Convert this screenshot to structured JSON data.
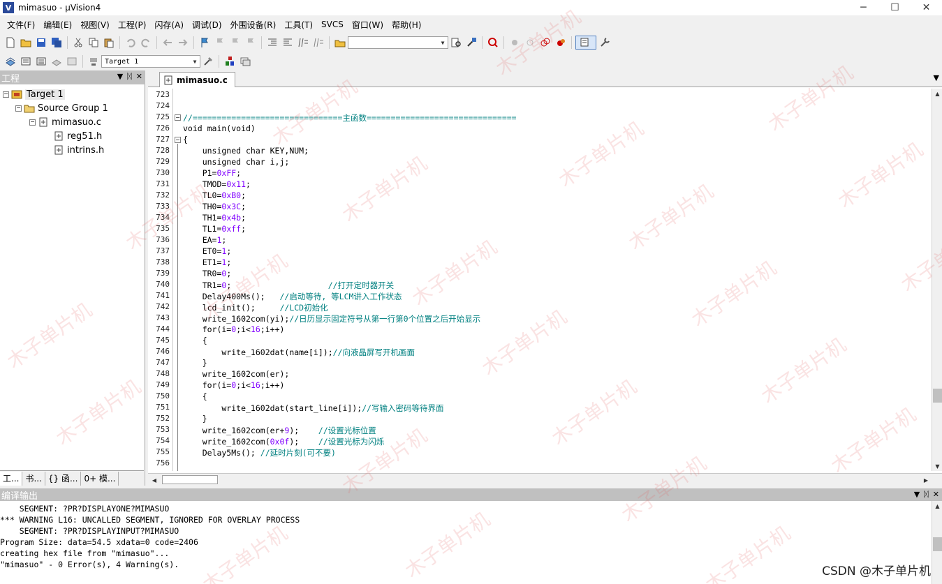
{
  "window": {
    "title": "mimasuo - µVision4",
    "app_icon": "V",
    "minimize": "─",
    "maximize": "☐",
    "close": "✕"
  },
  "menu": [
    "文件(F)",
    "编辑(E)",
    "视图(V)",
    "工程(P)",
    "闪存(A)",
    "调试(D)",
    "外围设备(R)",
    "工具(T)",
    "SVCS",
    "窗口(W)",
    "帮助(H)"
  ],
  "toolbar2": {
    "target_select": "Target 1"
  },
  "project_panel": {
    "title": "工程",
    "tree": {
      "target": "Target 1",
      "group": "Source Group 1",
      "file": "mimasuo.c",
      "include1": "reg51.h",
      "include2": "intrins.h"
    },
    "tabs": [
      "工...",
      "书...",
      "{} 函...",
      "0+ 模..."
    ]
  },
  "editor": {
    "active_tab": "mimasuo.c",
    "line_numbers": [
      "723",
      "724",
      "725",
      "726",
      "727",
      "728",
      "729",
      "730",
      "731",
      "732",
      "733",
      "734",
      "735",
      "736",
      "737",
      "738",
      "739",
      "740",
      "741",
      "742",
      "743",
      "744",
      "745",
      "746",
      "747",
      "748",
      "749",
      "750",
      "751",
      "752",
      "753",
      "754",
      "755",
      "756"
    ],
    "lines": {
      "l723": "",
      "l724": "",
      "l725": "//===============================主函数===============================",
      "l726": "void main(void)",
      "l727": "{",
      "l728": "    unsigned char KEY,NUM;",
      "l729": "    unsigned char i,j;",
      "l730a": "    P1=",
      "l730b": "0xFF",
      "l730c": ";",
      "l731a": "    TMOD=",
      "l731b": "0x11",
      "l731c": ";",
      "l732a": "    TL0=",
      "l732b": "0xB0",
      "l732c": ";",
      "l733a": "    TH0=",
      "l733b": "0x3C",
      "l733c": ";",
      "l734a": "    TH1=",
      "l734b": "0x4b",
      "l734c": ";",
      "l735a": "    TL1=",
      "l735b": "0xff",
      "l735c": ";",
      "l736a": "    EA=",
      "l736b": "1",
      "l736c": ";",
      "l737a": "    ET0=",
      "l737b": "1",
      "l737c": ";",
      "l738a": "    ET1=",
      "l738b": "1",
      "l738c": ";",
      "l739a": "    TR0=",
      "l739b": "0",
      "l739c": ";",
      "l740a": "    TR1=",
      "l740b": "0",
      "l740c": ";                    ",
      "l740d": "//打开定时器开关",
      "l741a": "    Delay400Ms();   ",
      "l741b": "//启动等待, 等LCM讲入工作状态",
      "l742a": "    lcd_init();     ",
      "l742b": "//LCD初始化",
      "l743a": "    write_1602com(yi);",
      "l743b": "//日历显示固定符号从第一行第0个位置之后开始显示",
      "l744a": "    for(i=",
      "l744b": "0",
      "l744c": ";i<",
      "l744d": "16",
      "l744e": ";i++)",
      "l745": "    {",
      "l746a": "        write_1602dat(name[i]);",
      "l746b": "//向液晶屏写开机画面",
      "l747": "    }",
      "l748": "    write_1602com(er);",
      "l749a": "    for(i=",
      "l749b": "0",
      "l749c": ";i<",
      "l749d": "16",
      "l749e": ";i++)",
      "l750": "    {",
      "l751a": "        write_1602dat(start_line[i]);",
      "l751b": "//写输入密码等待界面",
      "l752": "    }",
      "l753a": "    write_1602com(er+",
      "l753b": "9",
      "l753c": ");    ",
      "l753d": "//设置光标位置",
      "l754a": "    write_1602com(",
      "l754b": "0x0f",
      "l754c": ");    ",
      "l754d": "//设置光标为闪烁",
      "l755a": "    Delay5Ms(); ",
      "l755b": "//延时片刻(可不要)",
      "l756": ""
    }
  },
  "output": {
    "title": "编译输出",
    "lines": [
      "    SEGMENT: ?PR?DISPLAYONE?MIMASUO",
      "*** WARNING L16: UNCALLED SEGMENT, IGNORED FOR OVERLAY PROCESS",
      "    SEGMENT: ?PR?DISPLAYINPUT?MIMASUO",
      "Program Size: data=54.5 xdata=0 code=2406",
      "creating hex file from \"mimasuo\"...",
      "\"mimasuo\" - 0 Error(s), 4 Warning(s)."
    ]
  },
  "watermark": {
    "corner": "CSDN @木子单片机",
    "diagonal": "木子单片机"
  },
  "colors": {
    "comment": "#008080",
    "number": "#8000ff",
    "panel_header": "#c0c0c0"
  }
}
